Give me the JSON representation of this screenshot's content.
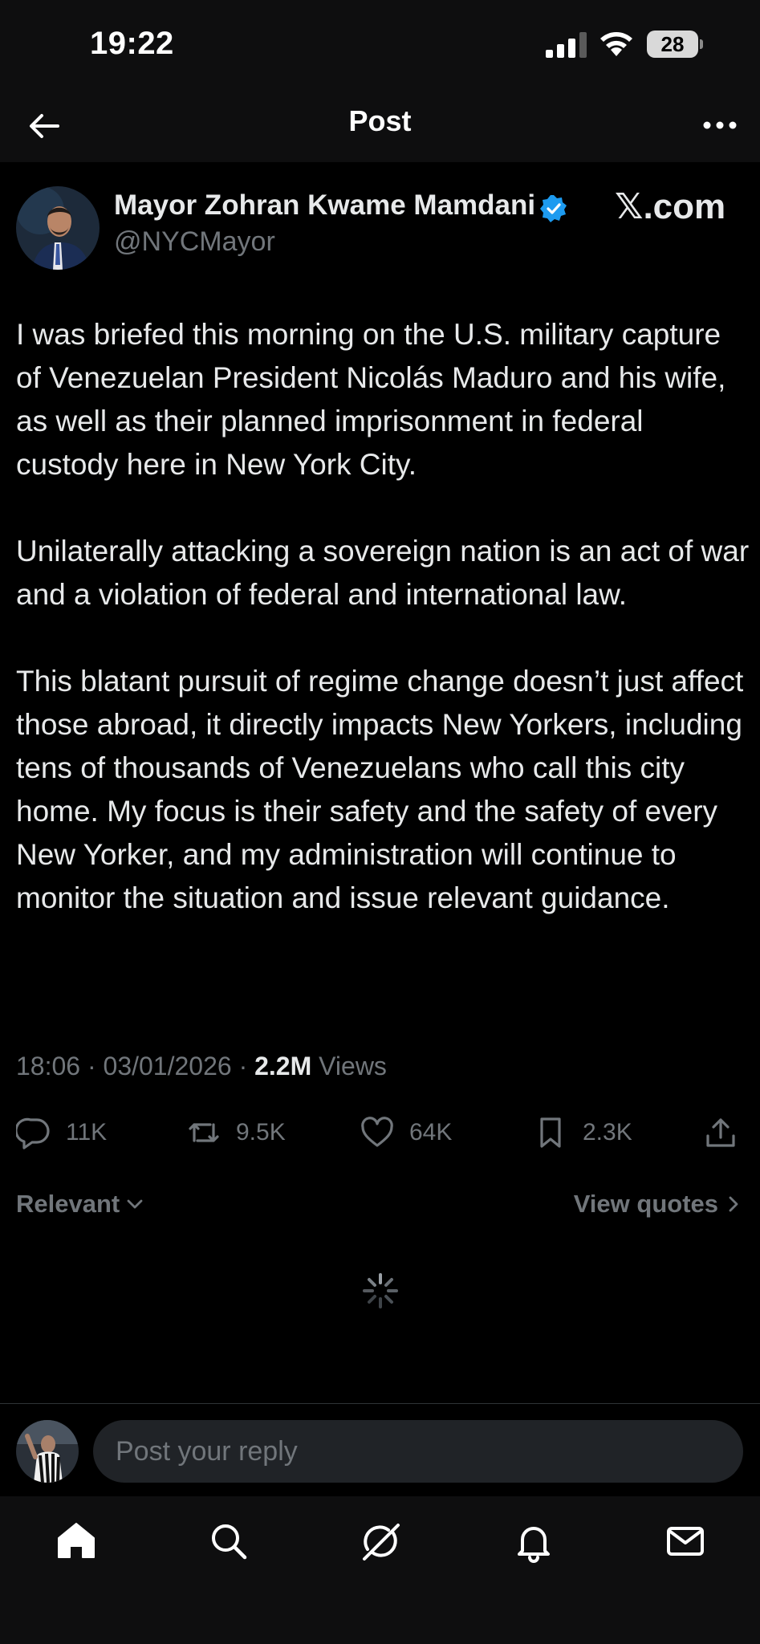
{
  "status_bar": {
    "time": "19:22",
    "battery": "28"
  },
  "nav": {
    "title": "Post"
  },
  "post": {
    "author_name": "Mayor Zohran Kwame Mamdani",
    "handle": "@NYCMayor",
    "watermark": "𝕏.com",
    "paragraphs": [
      "I was briefed this morning on the U.S. military capture of Venezuelan President Nicolás Maduro and his wife, as well as their planned imprisonment in federal custody here in New York City.",
      "Unilaterally attacking a sovereign nation is an act of war and a violation of federal and international law.",
      "This blatant pursuit of regime change doesn’t just affect those abroad, it directly impacts New Yorkers, including tens of thousands of Venezuelans who call this city home. My focus is their safety and the safety of every New Yorker, and my administration will continue to monitor the situation and issue relevant guidance."
    ],
    "time": "18:06",
    "date": "03/01/2026",
    "views_count": "2.2M",
    "views_label": "Views"
  },
  "actions": {
    "replies": "11K",
    "reposts": "9.5K",
    "likes": "64K",
    "bookmarks": "2.3K"
  },
  "replies_bar": {
    "sort_label": "Relevant",
    "view_quotes": "View quotes"
  },
  "reply": {
    "placeholder": "Post your reply"
  },
  "colors": {
    "background": "#000000",
    "text": "#e7e9ea",
    "muted": "#71767b",
    "verified": "#1d9bf0",
    "input_bg": "#202327"
  }
}
